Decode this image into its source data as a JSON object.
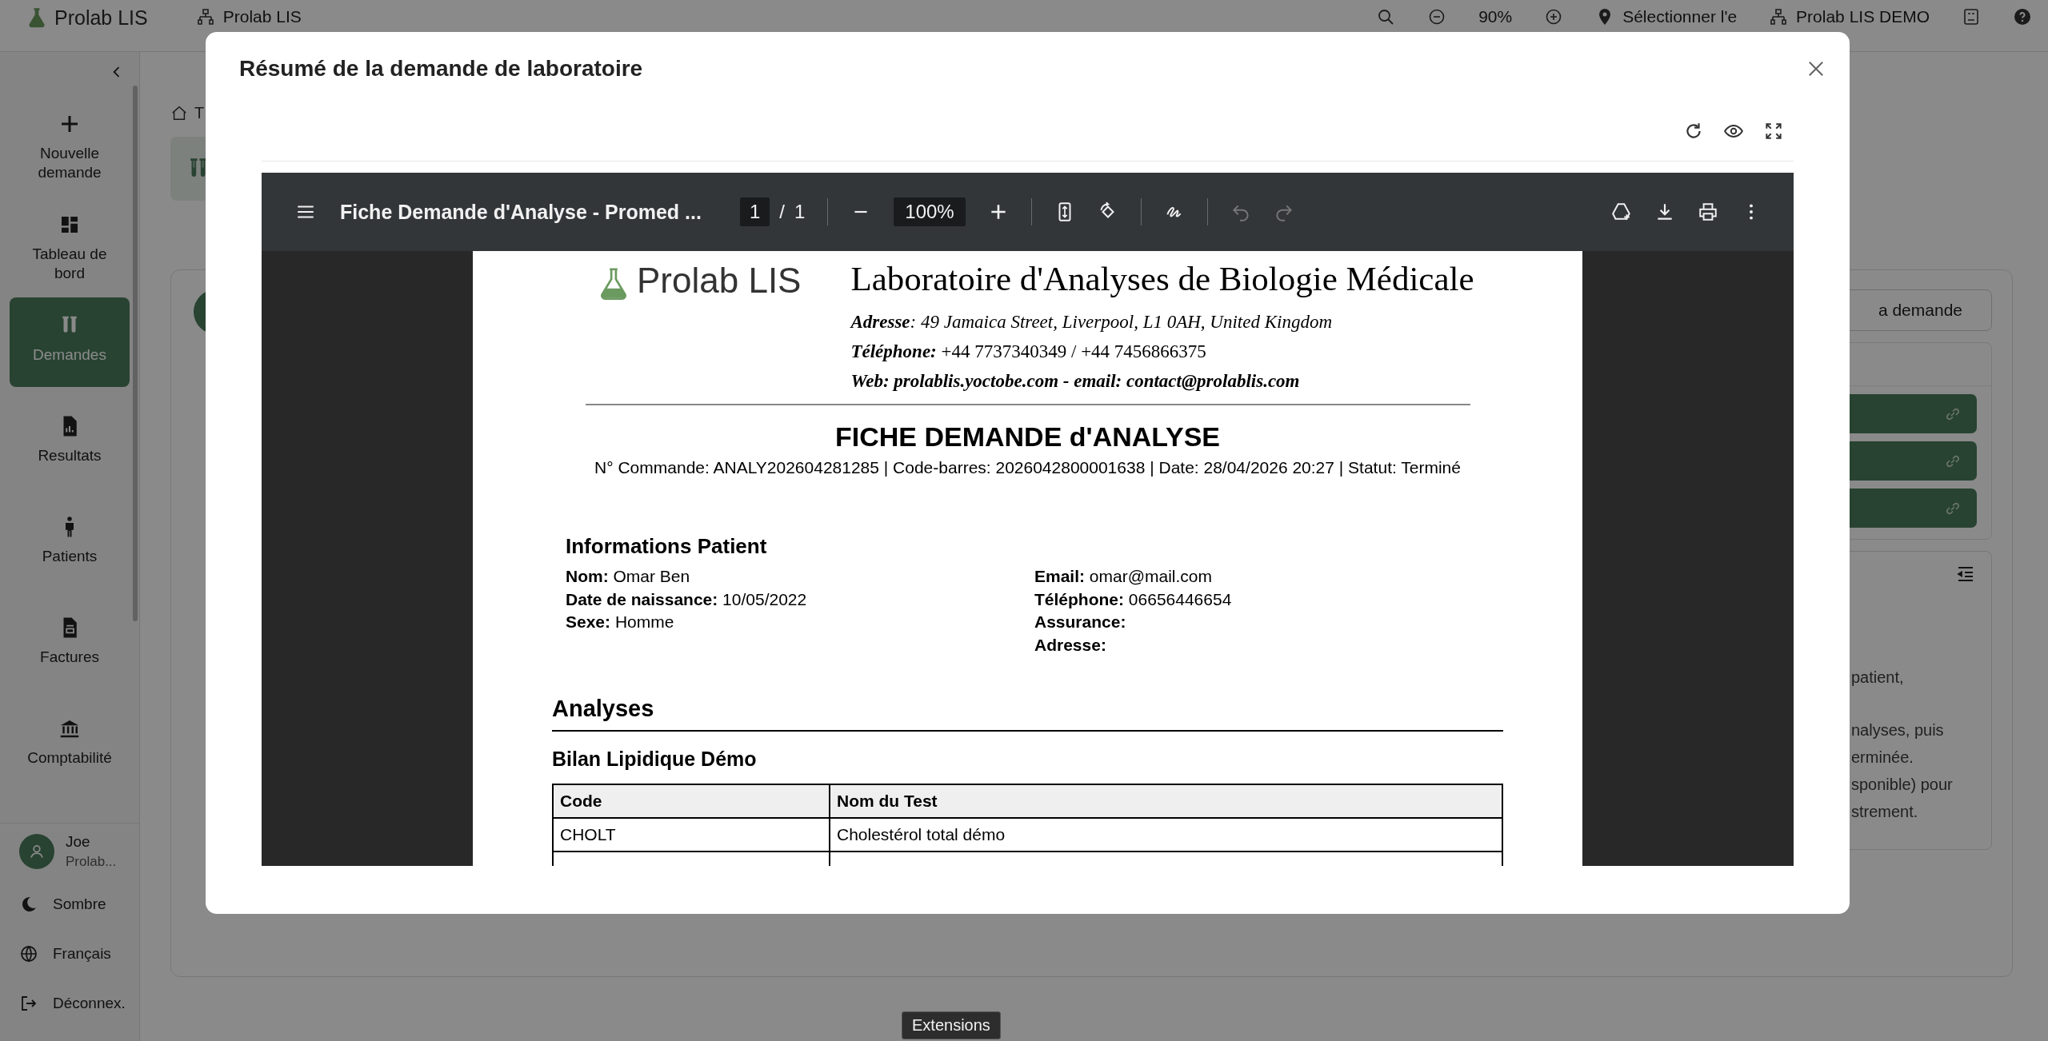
{
  "topbar": {
    "logo": "Prolab LIS",
    "workspace": "Prolab LIS",
    "zoom": "90%",
    "location": "Sélectionner l'e",
    "account": "Prolab LIS DEMO"
  },
  "sidebar": {
    "items": [
      {
        "label": "Nouvelle demande",
        "selected": false
      },
      {
        "label": "Tableau de bord",
        "selected": false
      },
      {
        "label": "Demandes",
        "selected": true
      },
      {
        "label": "Resultats",
        "selected": false
      },
      {
        "label": "Patients",
        "selected": false
      },
      {
        "label": "Factures",
        "selected": false
      },
      {
        "label": "Comptabilité",
        "selected": false
      }
    ],
    "user": {
      "name": "Joe",
      "org": "Prolab..."
    },
    "footer": [
      {
        "label": "Sombre"
      },
      {
        "label": "Français"
      },
      {
        "label": "Déconnex."
      }
    ]
  },
  "page": {
    "breadcrumb": "T",
    "action_button": "a demande",
    "links": [
      {
        "kind": "link"
      },
      {
        "kind": "link"
      },
      {
        "kind": "link"
      }
    ],
    "help_lines": [
      "patient,",
      "nalyses, puis",
      "erminée.",
      "sponible) pour",
      "strement."
    ]
  },
  "modal": {
    "title": "Résumé de la demande de laboratoire",
    "viewer": {
      "title": "Fiche Demande d'Analyse - Promed ...",
      "page": "1",
      "separator": "/",
      "page_count": "1",
      "zoom": "100%",
      "undo_disabled": true,
      "redo_disabled": true
    },
    "document": {
      "logo": "Prolab LIS",
      "lab_name": "Laboratoire d'Analyses de Biologie Médicale",
      "contact": [
        {
          "kind": "italic",
          "text": "**Adresse**: 49 Jamaica Street, Liverpool, L1 0AH, United Kingdom"
        },
        {
          "kind": "plain",
          "text": "**Téléphone:** +44 7737340349 / +44 7456866375"
        },
        {
          "kind": "bold",
          "text": "Web: prolablis.yoctobe.com - email: contact@prolablis.com"
        }
      ],
      "heading": "FICHE DEMANDE d'ANALYSE",
      "meta": "N° Commande: ANALY202604281285 | Code-barres: 2026042800001638 | Date: 28/04/2026 20:27 | Statut: Terminé",
      "patient_title": "Informations Patient",
      "patient_left": [
        {
          "label": "Nom:",
          "value": "Omar Ben"
        },
        {
          "label": "Date de naissance:",
          "value": "10/05/2022"
        },
        {
          "label": "Sexe:",
          "value": "Homme"
        }
      ],
      "patient_right": [
        {
          "label": "Email:",
          "value": "omar@mail.com"
        },
        {
          "label": "Téléphone:",
          "value": "06656446654"
        },
        {
          "label": "Assurance:"
        },
        {
          "label": "Adresse:"
        }
      ],
      "analyses_title": "Analyses",
      "group_title": "Bilan Lipidique Démo",
      "table": {
        "columns": [
          "Code",
          "Nom du Test"
        ],
        "rows": [
          [
            "CHOLT",
            "Cholestérol total démo"
          ]
        ]
      }
    }
  },
  "tooltip": "Extensions"
}
